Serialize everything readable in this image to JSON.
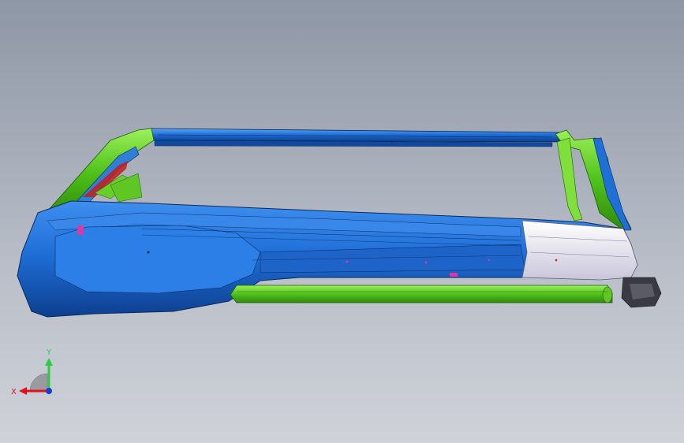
{
  "viewport": {
    "background_top": "#8e97a6",
    "background_bottom": "#cfd2d8"
  },
  "model": {
    "part_colors": {
      "primary": "#1e6fd6",
      "secondary": "#58c51c",
      "highlight": "#e9e7f2",
      "accent": "#c21d1d"
    }
  },
  "triad": {
    "x_label": "X",
    "y_label": "Y",
    "x_color": "#e0131a",
    "y_color": "#2ecc40",
    "z_color": "#1a3bd1"
  }
}
